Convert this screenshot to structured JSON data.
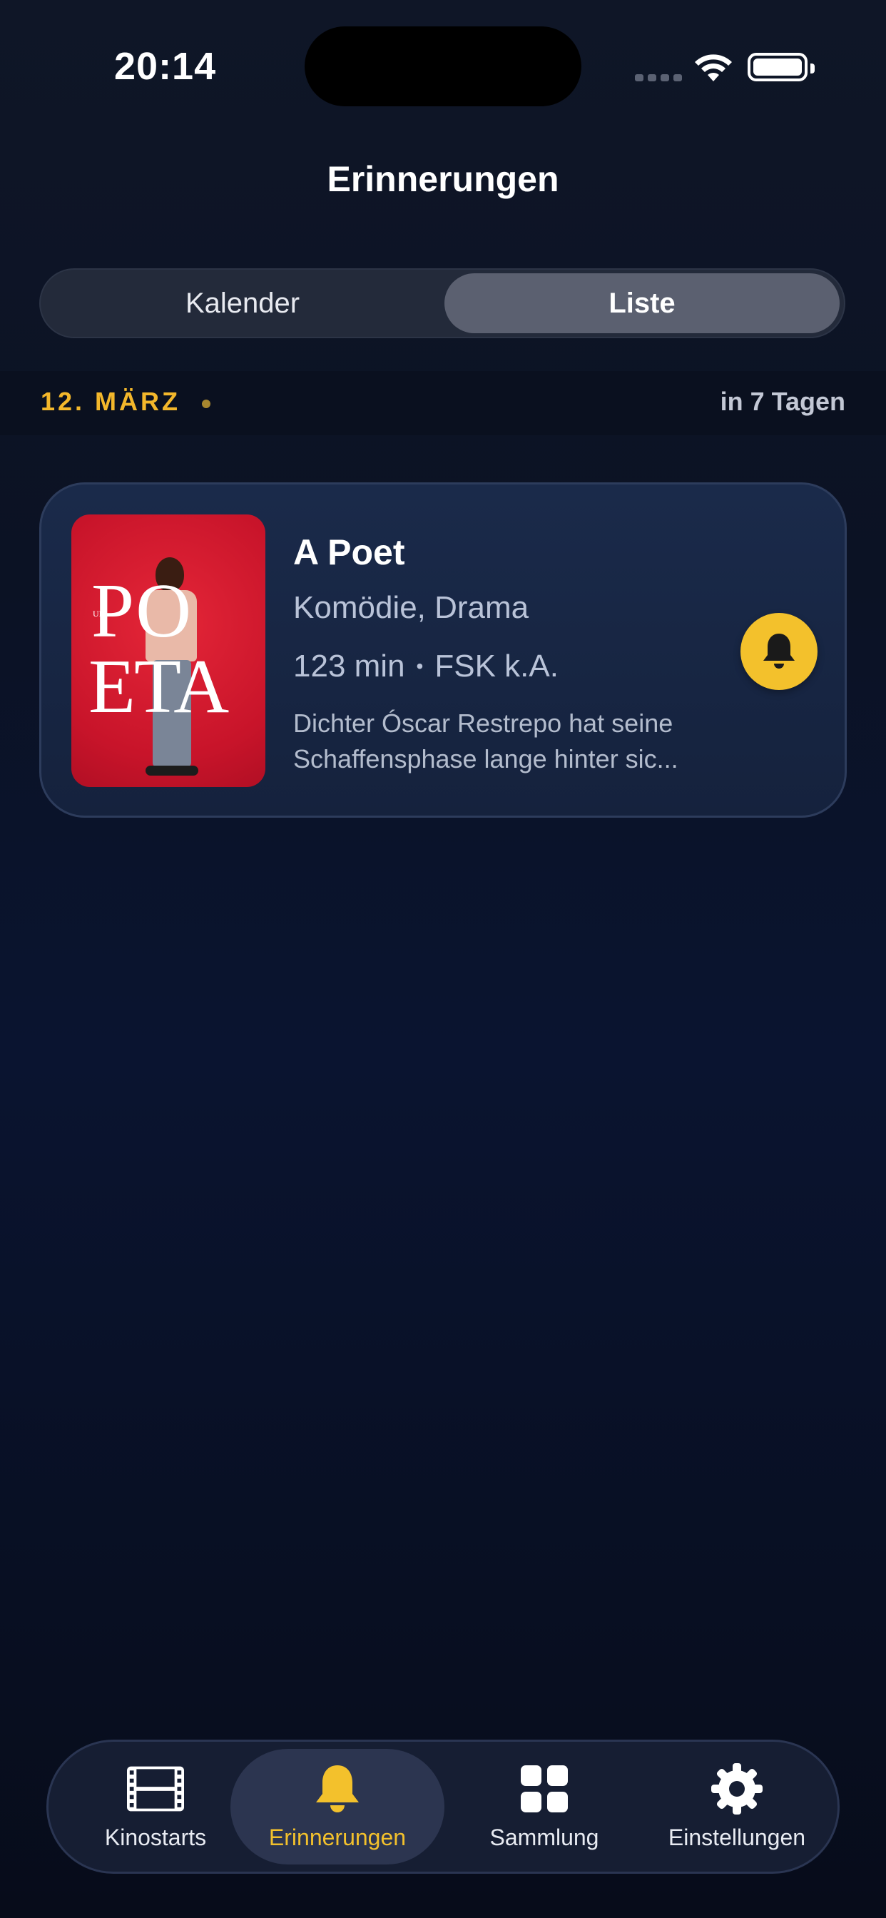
{
  "status_bar": {
    "time": "20:14"
  },
  "header": {
    "title": "Erinnerungen"
  },
  "segmented_control": {
    "options": [
      {
        "label": "Kalender",
        "selected": false
      },
      {
        "label": "Liste",
        "selected": true
      }
    ]
  },
  "section": {
    "date_label": "12. MÄRZ",
    "days_away": "in 7 Tagen"
  },
  "movie_card": {
    "title": "A Poet",
    "genre": "Komödie, Drama",
    "runtime": "123 min",
    "rating": "FSK k.A.",
    "description": "Dichter Óscar Restrepo hat seine Schaffensphase lange hinter sic...",
    "poster": {
      "line1": "PO",
      "line2": "ETA",
      "small": "UN"
    },
    "reminder_icon": "bell-icon"
  },
  "tab_bar": {
    "tabs": [
      {
        "label": "Kinostarts",
        "icon": "film-icon"
      },
      {
        "label": "Erinnerungen",
        "icon": "bell-icon",
        "active": true
      },
      {
        "label": "Sammlung",
        "icon": "grid-icon"
      },
      {
        "label": "Einstellungen",
        "icon": "gear-icon"
      }
    ]
  },
  "colors": {
    "accent": "#f3c12c",
    "date_accent": "#f3b72b",
    "background": "#0b1224",
    "card": "#1a2a4a"
  }
}
